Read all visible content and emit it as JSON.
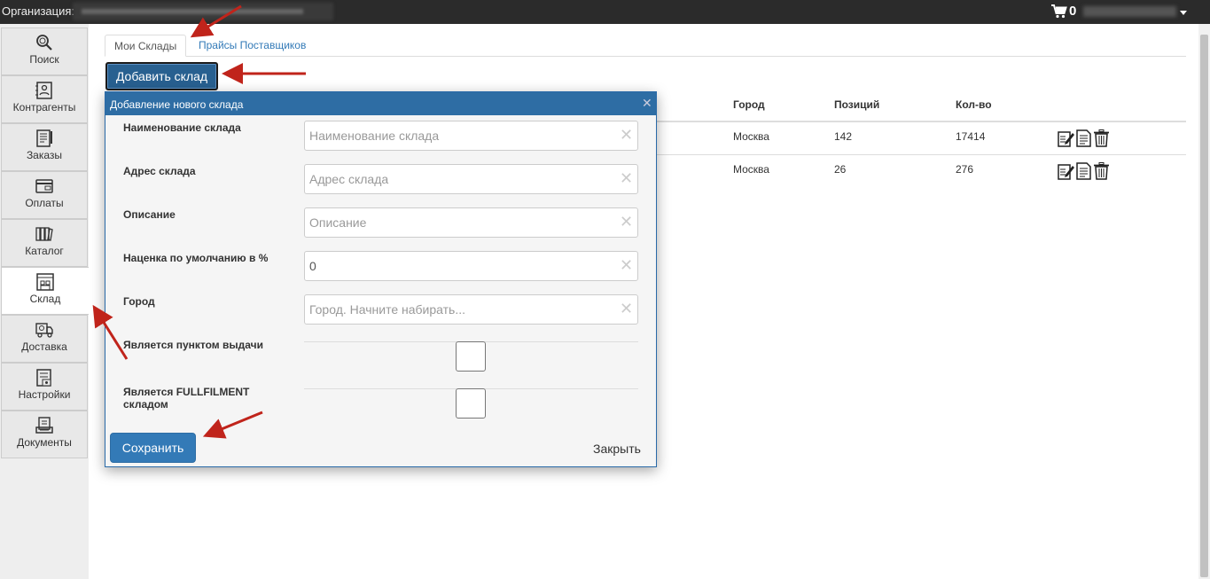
{
  "topbar": {
    "org_label": "Организация:",
    "cart_count": "0"
  },
  "sidebar": {
    "items": [
      {
        "label": "Поиск",
        "icon": "search-icon"
      },
      {
        "label": "Контрагенты",
        "icon": "contacts-icon"
      },
      {
        "label": "Заказы",
        "icon": "orders-icon"
      },
      {
        "label": "Оплаты",
        "icon": "payments-icon"
      },
      {
        "label": "Каталог",
        "icon": "catalog-icon"
      },
      {
        "label": "Склад",
        "icon": "warehouse-icon",
        "active": true
      },
      {
        "label": "Доставка",
        "icon": "delivery-icon"
      },
      {
        "label": "Настройки",
        "icon": "settings-icon"
      },
      {
        "label": "Документы",
        "icon": "documents-icon"
      }
    ]
  },
  "tabs": [
    {
      "label": "Мои Склады",
      "active": true
    },
    {
      "label": "Прайсы Поставщиков",
      "active": false
    }
  ],
  "add_button_label": "Добавить склад",
  "table": {
    "headers": {
      "city": "Город",
      "positions": "Позиций",
      "qty": "Кол-во"
    },
    "rows": [
      {
        "city": "Москва",
        "positions": "142",
        "qty": "17414"
      },
      {
        "city": "Москва",
        "positions": "26",
        "qty": "276"
      }
    ]
  },
  "dialog": {
    "title": "Добавление нового склада",
    "fields": {
      "name": {
        "label": "Наименование склада",
        "placeholder": "Наименование склада",
        "value": ""
      },
      "address": {
        "label": "Адрес склада",
        "placeholder": "Адрес склада",
        "value": ""
      },
      "description": {
        "label": "Описание",
        "placeholder": "Описание",
        "value": ""
      },
      "markup": {
        "label": "Наценка по умолчанию в %",
        "placeholder": "",
        "value": "0"
      },
      "city": {
        "label": "Город",
        "placeholder": "Город. Начните набирать...",
        "value": ""
      },
      "pickup": {
        "label": "Является пунктом выдачи",
        "checked": false
      },
      "fulfillment": {
        "label_line1": "Является FULLFILMENT",
        "label_line2": "складом",
        "checked": false
      }
    },
    "save_label": "Сохранить",
    "close_label": "Закрыть"
  },
  "colors": {
    "topbar": "#2b2b2b",
    "primary": "#337ab7",
    "dialog_header": "#2e6da4",
    "annotation_arrow": "#c0241b"
  }
}
